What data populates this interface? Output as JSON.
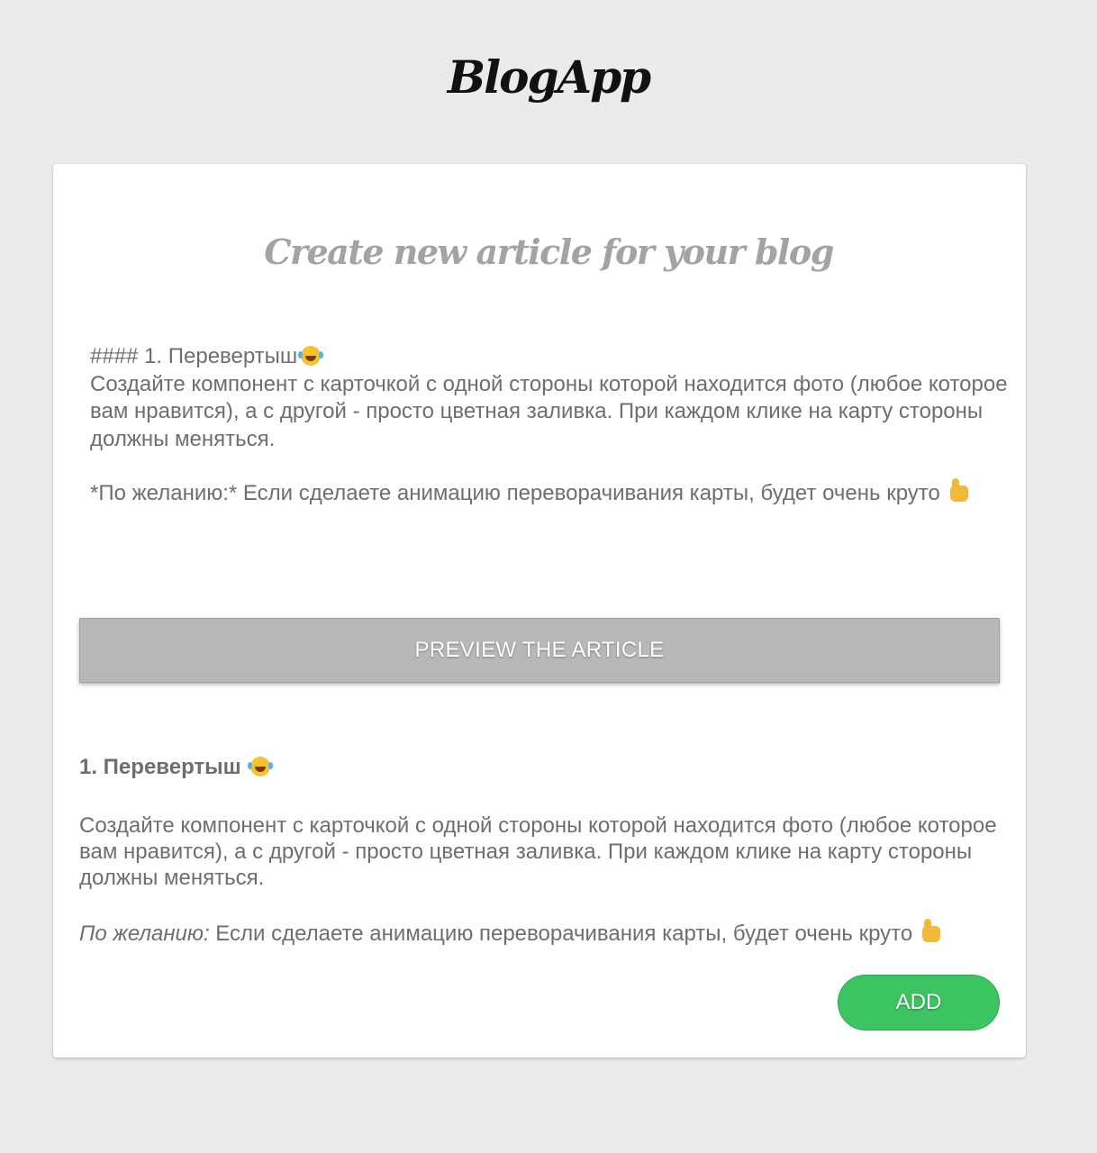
{
  "app": {
    "logo": "BlogApp"
  },
  "card": {
    "title": "Create new article for your blog"
  },
  "editor": {
    "line1": "#### 1. Перевертыш",
    "line1_emoji": "laughing-tears-emoji",
    "paragraph1": "Создайте компонент с карточкой с одной стороны которой находится фото (любое которое вам нравится), а с другой - просто цветная заливка. При каждом клике на карту стороны должны меняться.",
    "paragraph2": "*По желанию:* Если сделаете анимацию переворачивания карты, будет очень круто",
    "paragraph2_emoji": "thumbs-up-emoji"
  },
  "buttons": {
    "preview_label": "PREVIEW THE ARTICLE",
    "add_label": "ADD"
  },
  "preview": {
    "heading": "1. Перевертыш",
    "heading_emoji": "laughing-tears-emoji",
    "paragraph1": "Создайте компонент с карточкой с одной стороны которой находится фото (любое которое вам нравится), а с другой - просто цветная заливка. При каждом клике на карту стороны должны меняться.",
    "paragraph2_em": "По желанию:",
    "paragraph2_rest": " Если сделаете анимацию переворачивания карты, будет очень круто",
    "paragraph2_emoji": "thumbs-up-emoji"
  },
  "colors": {
    "background": "#ebebeb",
    "card": "#ffffff",
    "title_gray": "#a3a3a3",
    "text_gray": "#6e6e6e",
    "preview_button": "#b8b8b8",
    "add_button": "#3cc462"
  }
}
